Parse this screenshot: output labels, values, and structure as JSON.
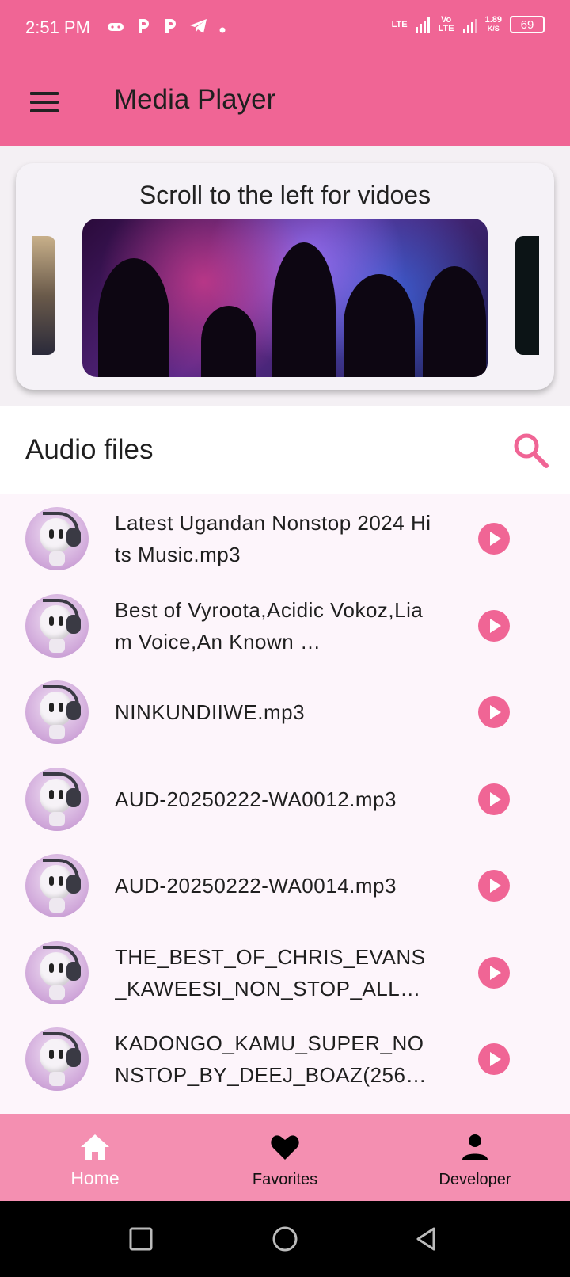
{
  "status_bar": {
    "time": "2:51 PM",
    "net1": "LTE",
    "net2": "Vo LTE",
    "speed": "1.89",
    "speed_unit": "K/S",
    "battery": "69"
  },
  "app_bar": {
    "title": "Media Player",
    "menu_icon": "hamburger-menu-icon"
  },
  "carousel": {
    "caption": "Scroll to the left for vidoes"
  },
  "audio_section": {
    "title": "Audio files",
    "search_icon": "search-icon"
  },
  "audio_files": [
    {
      "title": "Latest Ugandan Nonstop 2024 Hits Music.mp3"
    },
    {
      "title": "Best of Vyroota,Acidic Vokoz,Liam Voice,An Known …"
    },
    {
      "title": "NINKUNDIIWE.mp3"
    },
    {
      "title": "AUD-20250222-WA0012.mp3"
    },
    {
      "title": "AUD-20250222-WA0014.mp3"
    },
    {
      "title": "THE_BEST_OF_CHRIS_EVANS_KAWEESI_NON_STOP_ALL_S…"
    },
    {
      "title": "KADONGO_KAMU_SUPER_NONSTOP_BY_DEEJ_BOAZ(256k…"
    }
  ],
  "bottom_nav": {
    "items": [
      {
        "label": "Home",
        "icon": "home-icon"
      },
      {
        "label": "Favorites",
        "icon": "heart-icon"
      },
      {
        "label": "Developer",
        "icon": "person-icon"
      }
    ]
  },
  "colors": {
    "primary": "#f06595",
    "nav_background": "#f48fb1",
    "list_background": "#fdf5fb"
  }
}
